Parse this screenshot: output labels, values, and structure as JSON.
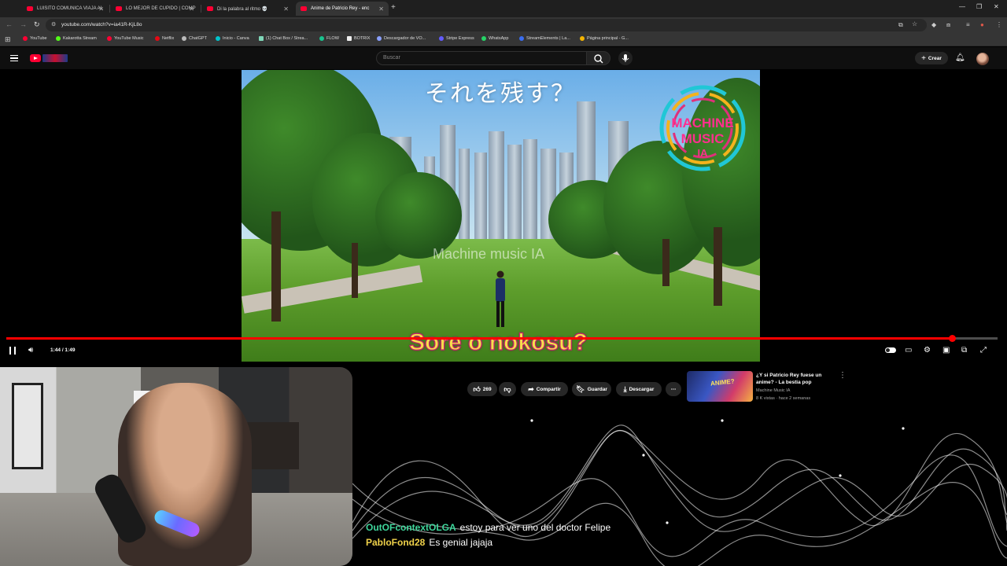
{
  "browser": {
    "tabs": [
      {
        "title": "LUISITO COMUNICA VIAJA AL"
      },
      {
        "title": "LO MEJOR DE CUPIDO | COMP"
      },
      {
        "title": "Di la palabra al ritmo 💀"
      },
      {
        "title": "Anime de Patricio Rey - enc"
      }
    ],
    "new_tab": "+",
    "url": "youtube.com/watch?v=ia41R-KjL8o",
    "bookmarks": [
      {
        "label": "YouTube",
        "color": "#ff0033"
      },
      {
        "label": "Kakarotta Stream",
        "color": "#53fc18"
      },
      {
        "label": "YouTube Music",
        "color": "#ff0033"
      },
      {
        "label": "Netflix",
        "color": "#e50914"
      },
      {
        "label": "ChatGPT",
        "color": "#bbbbbb"
      },
      {
        "label": "Inicio - Canva",
        "color": "#00c4cc"
      },
      {
        "label": "(1) Chat Box / Strea...",
        "color": "#7fd6b8"
      },
      {
        "label": "FLOW",
        "color": "#19c38e"
      },
      {
        "label": "BOTRIX",
        "color": "#eeeeee"
      },
      {
        "label": "Descargador de VO...",
        "color": "#8aa0ff"
      },
      {
        "label": "Stripe Express",
        "color": "#635bff"
      },
      {
        "label": "WhatsApp",
        "color": "#25d366"
      },
      {
        "label": "StreamElements | La...",
        "color": "#3a6df0"
      },
      {
        "label": "Página principal - G...",
        "color": "#f4b400"
      }
    ]
  },
  "youtube": {
    "search_placeholder": "Buscar",
    "create_label": "Crear",
    "video": {
      "overlay_japanese": "それを残す？",
      "watermark": "Machine music IA",
      "logo_line1": "MACHINE",
      "logo_line2": "MUSIC",
      "logo_line3": "IA",
      "subtitle": "Sore o nokosu?",
      "time": "1:44 / 1:49",
      "progress": 0.954
    },
    "actions": {
      "like_count": "269",
      "share": "Compartir",
      "save": "Guardar",
      "download": "Descargar"
    },
    "recommended": {
      "thumb_text": "ANIME?",
      "title": "¿Y si Patricio Rey fuese un anime? - La bestia pop",
      "channel": "Machine Music IA",
      "meta": "8 K vistas · hace 2 semanas"
    }
  },
  "chat": [
    {
      "user": "OutOFcontextOLGA",
      "message": "estoy para ver uno del doctor Felipe"
    },
    {
      "user": "PabloFond28",
      "message": "Es genial jajaja"
    }
  ],
  "colors": {
    "brand": "#ff0033",
    "progress": "#ff0000",
    "subtitle_fill": "#f4e14a",
    "subtitle_stroke": "#c8216a",
    "chat_user1": "#3fd69c",
    "chat_user2": "#f0d24a"
  }
}
